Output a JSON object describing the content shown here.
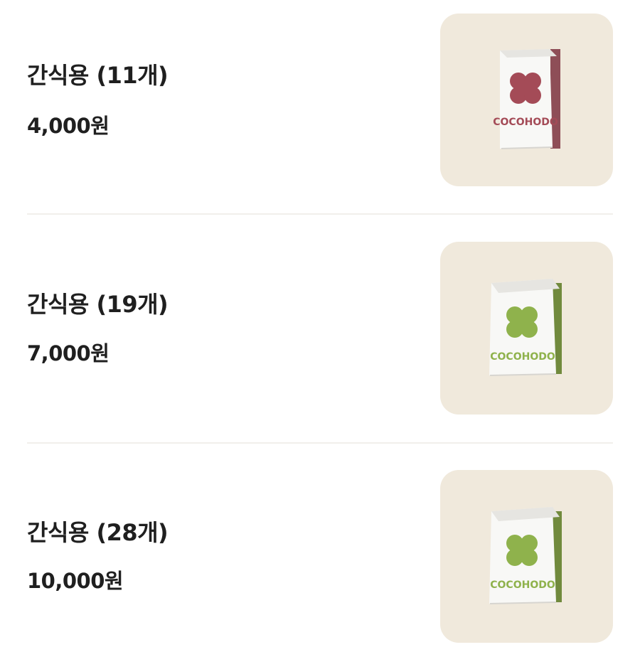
{
  "colors": {
    "background": "#ffffff",
    "text": "#1f1f1f",
    "divider": "#f1efeb",
    "thumbnail_background": "#f0e9dc",
    "bag": "#f8f8f6",
    "bag_shadow": "#e6e5e1",
    "red_accent": "#a44b57",
    "green_accent": "#8fb24c"
  },
  "menu": {
    "items": [
      {
        "name": "간식용 (11개)",
        "price": "4,000원",
        "image": {
          "icon": "cocohodo-red-bag",
          "accent": "#a44b57",
          "brand_text": "COCOHODO"
        }
      },
      {
        "name": "간식용 (19개)",
        "price": "7,000원",
        "image": {
          "icon": "cocohodo-green-bag",
          "accent": "#8fb24c",
          "brand_text": "COCOHODO"
        }
      },
      {
        "name": "간식용 (28개)",
        "price": "10,000원",
        "image": {
          "icon": "cocohodo-green-bag",
          "accent": "#8fb24c",
          "brand_text": "COCOHODO"
        }
      }
    ]
  }
}
